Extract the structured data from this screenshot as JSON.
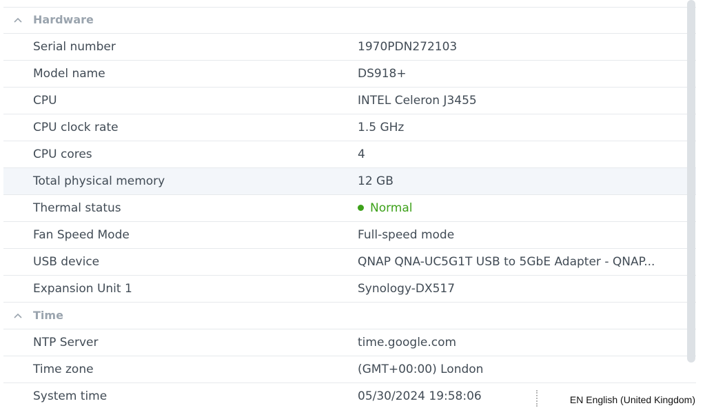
{
  "sections": {
    "hardware": {
      "title": "Hardware",
      "rows": [
        {
          "label": "Serial number",
          "value": "1970PDN272103"
        },
        {
          "label": "Model name",
          "value": "DS918+"
        },
        {
          "label": "CPU",
          "value": "INTEL Celeron J3455"
        },
        {
          "label": "CPU clock rate",
          "value": "1.5 GHz"
        },
        {
          "label": "CPU cores",
          "value": "4"
        },
        {
          "label": "Total physical memory",
          "value": "12 GB"
        },
        {
          "label": "Thermal status",
          "value": "Normal"
        },
        {
          "label": "Fan Speed Mode",
          "value": "Full-speed mode"
        },
        {
          "label": "USB device",
          "value": "QNAP QNA-UC5G1T USB to 5GbE Adapter - QNAP..."
        },
        {
          "label": "Expansion Unit 1",
          "value": "Synology-DX517"
        }
      ]
    },
    "time": {
      "title": "Time",
      "rows": [
        {
          "label": "NTP Server",
          "value": "time.google.com"
        },
        {
          "label": "Time zone",
          "value": "(GMT+00:00) London"
        },
        {
          "label": "System time",
          "value": "05/30/2024 19:58:06"
        }
      ]
    }
  },
  "colors": {
    "status_ok": "#3da11a",
    "section_title": "#9aa4ae",
    "row_hover": "#f3f6fa"
  },
  "icons": {
    "collapse": "chevron-up-icon",
    "status": "status-dot-icon"
  },
  "taskbar": {
    "language": "EN English (United Kingdom)"
  }
}
